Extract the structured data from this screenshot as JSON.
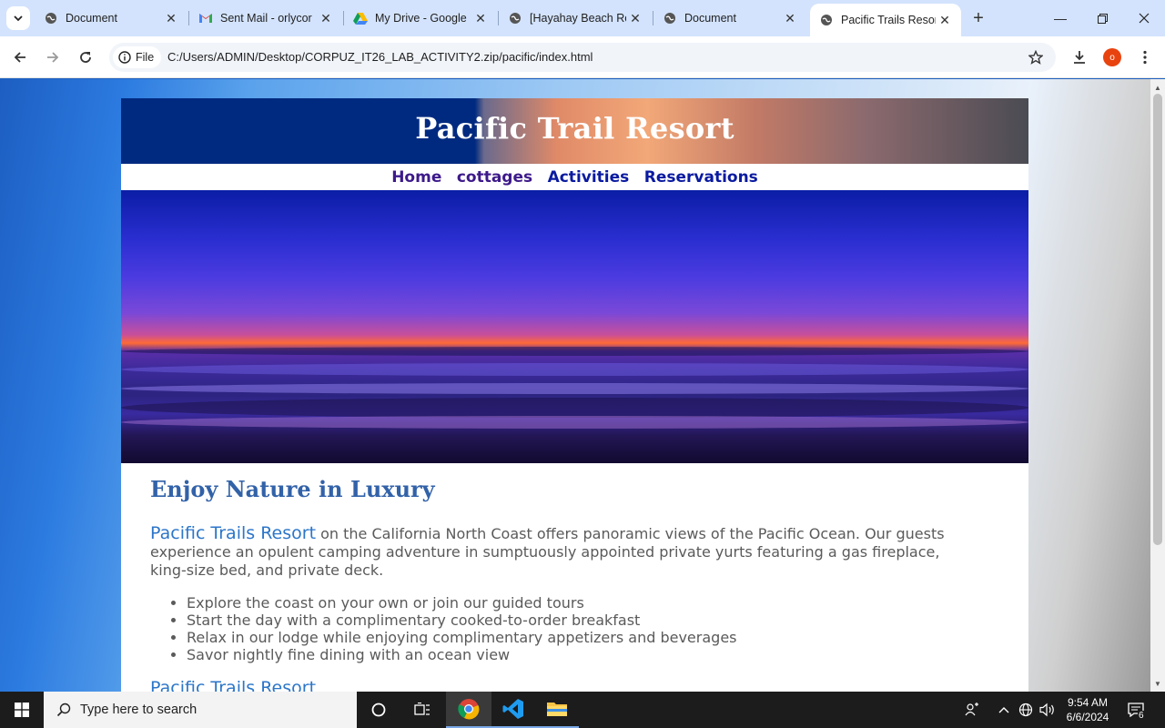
{
  "browser": {
    "tabs": [
      {
        "title": "Document",
        "icon": "globe-icon",
        "active": false
      },
      {
        "title": "Sent Mail - orlycor",
        "icon": "gmail-icon",
        "active": false
      },
      {
        "title": "My Drive - Google",
        "icon": "google-drive-icon",
        "active": false
      },
      {
        "title": "[Hayahay Beach Re",
        "icon": "globe-icon",
        "active": false
      },
      {
        "title": "Document",
        "icon": "globe-icon",
        "active": false
      },
      {
        "title": "Pacific Trails Resort",
        "icon": "globe-icon",
        "active": true
      }
    ],
    "address": {
      "chip_label": "File",
      "url": "C:/Users/ADMIN/Desktop/CORPUZ_IT26_LAB_ACTIVITY2.zip/pacific/index.html"
    },
    "profile_initial": "o"
  },
  "page": {
    "site_title": "Pacific Trail Resort",
    "nav": [
      "Home",
      "cottages",
      "Activities",
      "Reservations"
    ],
    "heading": "Enjoy Nature in Luxury",
    "intro_brand": "Pacific Trails Resort",
    "intro_text": " on the California North Coast offers panoramic views of the Pacific Ocean. Our guests experience an opulent camping adventure in sumptuously appointed private yurts featuring a gas fireplace, king-size bed, and private deck.",
    "features": [
      "Explore the coast on your own or join our guided tours",
      "Start the day with a complimentary cooked-to-order breakfast",
      "Relax in our lodge while enjoying complimentary appetizers and beverages",
      "Savor nightly fine dining with an ocean view"
    ],
    "footer_brand": "Pacific Trails Resort"
  },
  "taskbar": {
    "search_placeholder": "Type here to search",
    "time": "9:54 AM",
    "date": "6/6/2024",
    "notification_count": "6"
  },
  "colors": {
    "accent_blue": "#2c76c9",
    "heading_blue": "#3262a8",
    "header_navy": "#002a80"
  }
}
